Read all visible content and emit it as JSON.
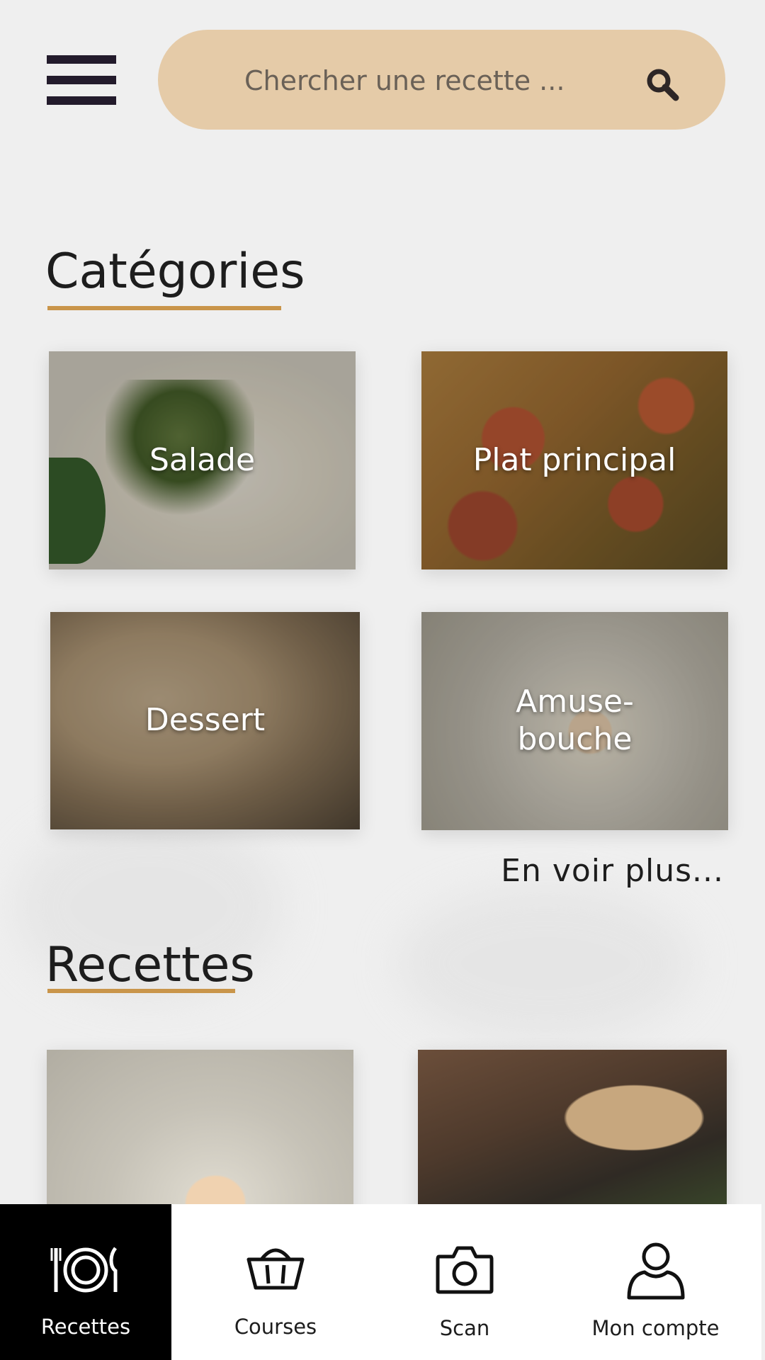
{
  "header": {
    "search": {
      "placeholder": "Chercher une recette ...",
      "value": ""
    }
  },
  "categories": {
    "title": "Catégories",
    "items": [
      {
        "label": "Salade"
      },
      {
        "label": "Plat principal"
      },
      {
        "label": "Dessert"
      },
      {
        "label": "Amuse-bouche"
      }
    ],
    "see_more": "En voir plus..."
  },
  "recipes": {
    "title": "Recettes"
  },
  "bottom_nav": {
    "items": [
      {
        "label": "Recettes",
        "icon": "plate-cutlery-icon",
        "active": true
      },
      {
        "label": "Courses",
        "icon": "basket-icon",
        "active": false
      },
      {
        "label": "Scan",
        "icon": "camera-icon",
        "active": false
      },
      {
        "label": "Mon compte",
        "icon": "user-icon",
        "active": false
      }
    ]
  },
  "colors": {
    "search_bg": "#e5cba8",
    "accent_underline": "#c9954a",
    "menu_icon": "#231b2c",
    "active_nav_bg": "#000000"
  }
}
